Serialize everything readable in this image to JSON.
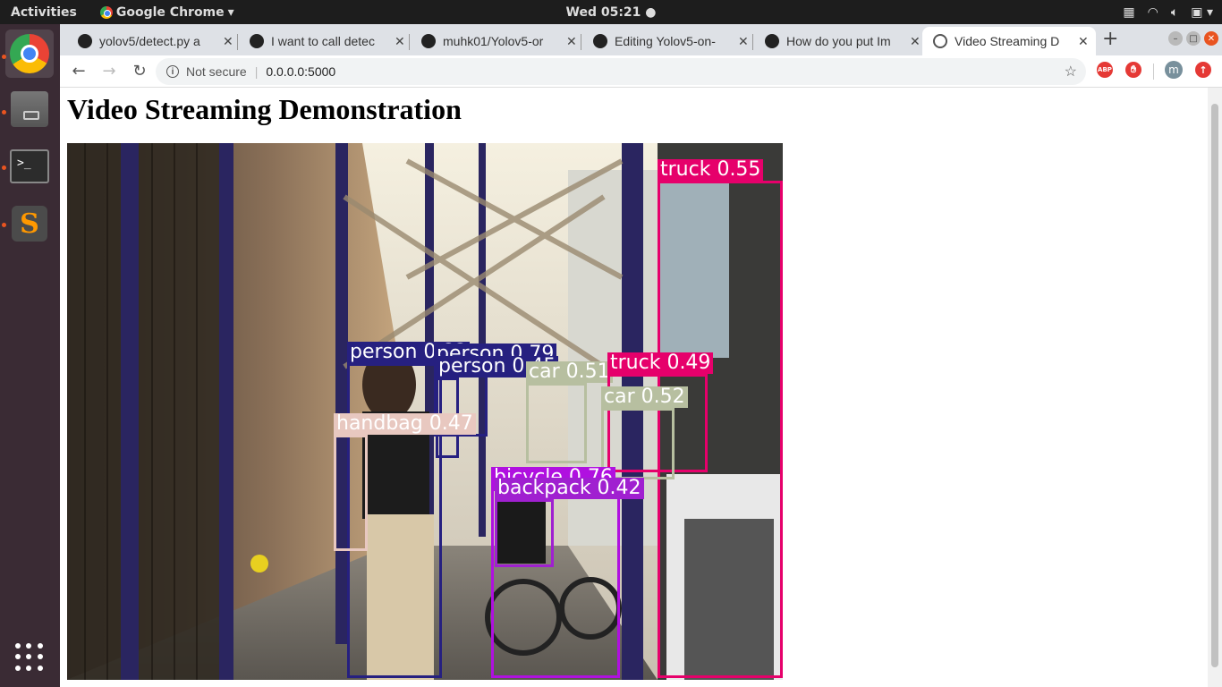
{
  "topbar": {
    "activities": "Activities",
    "app_name": "Google Chrome",
    "clock": "Wed 05:21 ●"
  },
  "tabs": [
    {
      "title": "yolov5/detect.py a",
      "icon": "github-icon"
    },
    {
      "title": "I want to call detec",
      "icon": "github-icon"
    },
    {
      "title": "muhk01/Yolov5-or",
      "icon": "github-icon"
    },
    {
      "title": "Editing Yolov5-on-",
      "icon": "github-icon"
    },
    {
      "title": "How do you put Im",
      "icon": "github-icon"
    },
    {
      "title": "Video Streaming D",
      "icon": "globe-icon",
      "active": true
    }
  ],
  "toolbar": {
    "not_secure": "Not secure",
    "url": "0.0.0.0:5000",
    "profile_initial": "m",
    "abp": "ABP"
  },
  "page": {
    "heading": "Video Streaming Demonstration"
  },
  "detections": [
    {
      "label": "truck 0.55",
      "color": "#e6006b"
    },
    {
      "label": "truck 0.49",
      "color": "#e6006b"
    },
    {
      "label": "person 0.82",
      "color": "#262080"
    },
    {
      "label": "person 0.79",
      "color": "#262080"
    },
    {
      "label": "person 0.45",
      "color": "#262080"
    },
    {
      "label": "car 0.51",
      "color": "#b7bfa0"
    },
    {
      "label": "car 0.52",
      "color": "#b7bfa0"
    },
    {
      "label": "handbag 0.47",
      "color": "#e8c8c0"
    },
    {
      "label": "backpack 0.42",
      "color": "#a020d0"
    },
    {
      "label": "bicycle 0.76",
      "color": "#b010e0"
    }
  ]
}
